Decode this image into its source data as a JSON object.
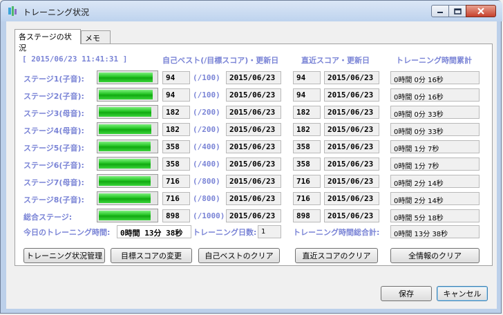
{
  "window": {
    "title": "トレーニング状況"
  },
  "tabs": [
    {
      "label": "各ステージの状況"
    },
    {
      "label": "メモ"
    }
  ],
  "headers": {
    "timestamp": "[ 2015/06/23 11:41:31 ]",
    "best": "自己ベスト(/目標スコア)・更新日",
    "recent": "直近スコア・更新日",
    "time": "トレーニング時間累計"
  },
  "stages": [
    {
      "label": "ステージ1(子音):",
      "progress": 0.94,
      "best": "94",
      "target": "(/100)",
      "best_date": "2015/06/23",
      "recent": "94",
      "recent_date": "2015/06/23",
      "time": "0時間 0分 16秒"
    },
    {
      "label": "ステージ2(子音):",
      "progress": 0.94,
      "best": "94",
      "target": "(/100)",
      "best_date": "2015/06/23",
      "recent": "94",
      "recent_date": "2015/06/23",
      "time": "0時間 0分 16秒"
    },
    {
      "label": "ステージ3(母音):",
      "progress": 0.91,
      "best": "182",
      "target": "(/200)",
      "best_date": "2015/06/23",
      "recent": "182",
      "recent_date": "2015/06/23",
      "time": "0時間 0分 33秒"
    },
    {
      "label": "ステージ4(母音):",
      "progress": 0.91,
      "best": "182",
      "target": "(/200)",
      "best_date": "2015/06/23",
      "recent": "182",
      "recent_date": "2015/06/23",
      "time": "0時間 0分 33秒"
    },
    {
      "label": "ステージ5(子音):",
      "progress": 0.9,
      "best": "358",
      "target": "(/400)",
      "best_date": "2015/06/23",
      "recent": "358",
      "recent_date": "2015/06/23",
      "time": "0時間 1分 7秒"
    },
    {
      "label": "ステージ6(子音):",
      "progress": 0.9,
      "best": "358",
      "target": "(/400)",
      "best_date": "2015/06/23",
      "recent": "358",
      "recent_date": "2015/06/23",
      "time": "0時間 1分 7秒"
    },
    {
      "label": "ステージ7(母音):",
      "progress": 0.9,
      "best": "716",
      "target": "(/800)",
      "best_date": "2015/06/23",
      "recent": "716",
      "recent_date": "2015/06/23",
      "time": "0時間 2分 14秒"
    },
    {
      "label": "ステージ8(子音):",
      "progress": 0.9,
      "best": "716",
      "target": "(/800)",
      "best_date": "2015/06/23",
      "recent": "716",
      "recent_date": "2015/06/23",
      "time": "0時間 2分 14秒"
    },
    {
      "label": "総合ステージ:",
      "progress": 0.9,
      "best": "898",
      "target": "(/1000)",
      "best_date": "2015/06/23",
      "recent": "898",
      "recent_date": "2015/06/23",
      "time": "0時間 5分 18秒"
    }
  ],
  "summary": {
    "today_label": "今日のトレーニング時間:",
    "today_value": "0時間 13分 38秒",
    "days_label": "トレーニング日数:",
    "days_value": "1",
    "total_label": "トレーニング時間総合計:",
    "total_value": "0時間 13分 38秒"
  },
  "actions": {
    "manage": "トレーニング状況管理",
    "change_target": "目標スコアの変更",
    "clear_best": "自己ベストのクリア",
    "clear_recent": "直近スコアのクリア",
    "clear_all": "全情報のクリア"
  },
  "footer": {
    "save": "保存",
    "cancel": "キャンセル"
  },
  "colors": {
    "label": "#7a84d6",
    "progress": "#22c322"
  }
}
